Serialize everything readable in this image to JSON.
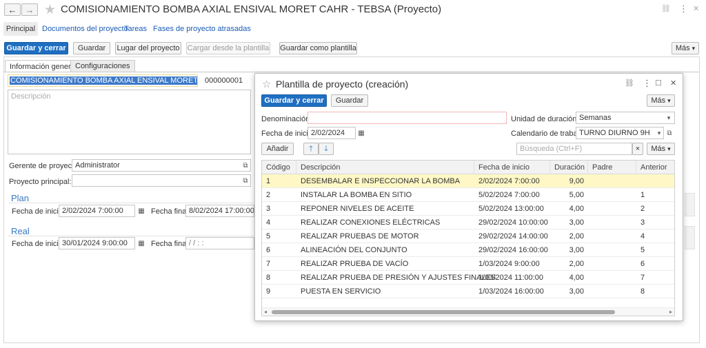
{
  "header": {
    "title": "COMISIONAMIENTO BOMBA AXIAL ENSIVAL MORET CAHR - TEBSA (Proyecto)"
  },
  "nav": {
    "items": [
      "Principal",
      "Documentos del proyecto",
      "Tareas",
      "Fases de proyecto atrasadas"
    ]
  },
  "toolbar": {
    "save_close": "Guardar y cerrar",
    "save": "Guardar",
    "project_place": "Lugar del proyecto",
    "load_template": "Cargar desde la plantilla",
    "save_template": "Guardar como plantilla",
    "more": "Más"
  },
  "tabs": [
    "Información general",
    "Configuraciones"
  ],
  "form": {
    "name_value": "COMISIONAMIENTO BOMBA AXIAL ENSIVAL MORET CAHR - ",
    "code_value": "000000001",
    "description_placeholder": "Descripción",
    "manager_label": "Gerente de proyecto:",
    "manager_value": "Administrator",
    "parent_label": "Proyecto principal:",
    "parent_value": "",
    "plan": {
      "title": "Plan",
      "start_label": "Fecha de inicio:",
      "start_value": "2/02/2024  7:00:00",
      "end_label": "Fecha final:",
      "end_value": "8/02/2024 17:00:00"
    },
    "real": {
      "title": "Real",
      "start_label": "Fecha de inicio:",
      "start_value": "30/01/2024  9:00:00",
      "end_label": "Fecha final:",
      "end_value": " /  /       :  :"
    }
  },
  "dialog": {
    "title": "Plantilla de proyecto (creación)",
    "save_close": "Guardar y cerrar",
    "save": "Guardar",
    "more": "Más",
    "name_label": "Denominación:",
    "name_value": "",
    "start_label": "Fecha de inicio:",
    "start_value": "2/02/2024",
    "duration_unit_label": "Unidad de duración:",
    "duration_unit_value": "Semanas",
    "calendar_label": "Calendario de trabajo:",
    "calendar_value": "TURNO DIURNO 9H",
    "add": "Añadir",
    "search_placeholder": "Búsqueda (Ctrl+F)",
    "more2": "Más",
    "columns": [
      "Código",
      "Descripción",
      "Fecha de inicio",
      "Duración",
      "Padre",
      "Anterior"
    ],
    "rows": [
      {
        "code": "1",
        "desc": "DESEMBALAR E INSPECCIONAR LA BOMBA",
        "start": "2/02/2024 7:00:00",
        "dur": "9,00",
        "parent": "",
        "prev": ""
      },
      {
        "code": "2",
        "desc": "INSTALAR LA BOMBA EN SITIO",
        "start": "5/02/2024 7:00:00",
        "dur": "5,00",
        "parent": "",
        "prev": "1"
      },
      {
        "code": "3",
        "desc": "REPONER NIVELES DE ACEITE",
        "start": "5/02/2024 13:00:00",
        "dur": "4,00",
        "parent": "",
        "prev": "2"
      },
      {
        "code": "4",
        "desc": "REALIZAR CONEXIONES ELÉCTRICAS",
        "start": "29/02/2024 10:00:00",
        "dur": "3,00",
        "parent": "",
        "prev": "3"
      },
      {
        "code": "5",
        "desc": "REALIZAR PRUEBAS DE MOTOR",
        "start": "29/02/2024 14:00:00",
        "dur": "2,00",
        "parent": "",
        "prev": "4"
      },
      {
        "code": "6",
        "desc": "ALINEACIÓN DEL CONJUNTO",
        "start": "29/02/2024 16:00:00",
        "dur": "3,00",
        "parent": "",
        "prev": "5"
      },
      {
        "code": "7",
        "desc": "REALIZAR PRUEBA DE VACÍO",
        "start": "1/03/2024 9:00:00",
        "dur": "2,00",
        "parent": "",
        "prev": "6"
      },
      {
        "code": "8",
        "desc": "REALIZAR PRUEBA DE PRESIÓN Y AJUSTES FINALES",
        "start": "1/03/2024 11:00:00",
        "dur": "4,00",
        "parent": "",
        "prev": "7"
      },
      {
        "code": "9",
        "desc": "PUESTA EN SERVICIO",
        "start": "1/03/2024 16:00:00",
        "dur": "3,00",
        "parent": "",
        "prev": "8"
      }
    ]
  },
  "icons": {
    "back": "←",
    "forward": "→",
    "star": "★",
    "star_outline": "☆",
    "link": "⛓",
    "kebab": "⋮",
    "close": "✕",
    "maximize": "□",
    "calendar": "▦",
    "open": "⧉",
    "dropdown": "▾",
    "up": "🡑",
    "down": "🡓",
    "clear": "×"
  },
  "colors": {
    "accent": "#1f6fc1",
    "link": "#1a5bb5",
    "selected_row": "#fff8c6",
    "group_title": "#3a78c2"
  }
}
